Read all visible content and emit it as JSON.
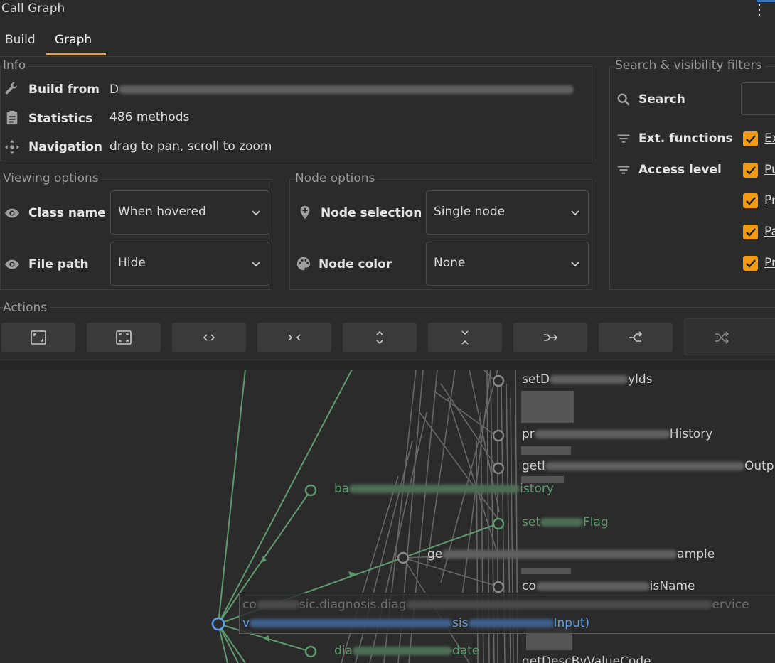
{
  "window": {
    "title": "Call Graph"
  },
  "tabs": [
    {
      "label": "Build",
      "active": false
    },
    {
      "label": "Graph",
      "active": true
    }
  ],
  "info": {
    "legend": "Info",
    "build_from": {
      "label": "Build from",
      "value_prefix": "D"
    },
    "statistics": {
      "label": "Statistics",
      "value": "486 methods"
    },
    "navigation": {
      "label": "Navigation",
      "value": "drag to pan, scroll to zoom"
    }
  },
  "viewing_options": {
    "legend": "Viewing options",
    "class_name": {
      "label": "Class name",
      "selected": "When hovered"
    },
    "file_path": {
      "label": "File path",
      "selected": "Hide"
    }
  },
  "node_options": {
    "legend": "Node options",
    "node_selection": {
      "label": "Node selection",
      "selected": "Single node"
    },
    "node_color": {
      "label": "Node color",
      "selected": "None"
    }
  },
  "filters": {
    "legend": "Search & visibility filters",
    "search": {
      "label": "Search",
      "value": ""
    },
    "ext_functions": {
      "label": "Ext. functions"
    },
    "access_level": {
      "label": "Access level"
    },
    "checkboxes": [
      {
        "label": "Ex",
        "checked": true
      },
      {
        "label": "Pu",
        "checked": true
      },
      {
        "label": "Pr",
        "checked": true
      },
      {
        "label": "Pa",
        "checked": true
      },
      {
        "label": "Pr",
        "checked": true
      }
    ]
  },
  "actions": {
    "legend": "Actions",
    "buttons": [
      {
        "icon": "fit-to-view-icon"
      },
      {
        "icon": "fit-selection-icon"
      },
      {
        "icon": "expand-horizontal-icon"
      },
      {
        "icon": "collapse-horizontal-icon"
      },
      {
        "icon": "expand-vertical-icon"
      },
      {
        "icon": "collapse-vertical-icon"
      },
      {
        "icon": "merge-right-icon"
      },
      {
        "icon": "split-right-icon"
      },
      {
        "icon": "shuffle-icon"
      }
    ]
  },
  "graph": {
    "nodes": [
      {
        "prefix": "setD",
        "suffix": "ylds",
        "color": "gray"
      },
      {
        "prefix": "pr",
        "suffix": "History",
        "color": "gray"
      },
      {
        "prefix": "getI",
        "suffix": "Outp",
        "color": "gray"
      },
      {
        "prefix": "ba",
        "suffix": "istory",
        "color": "green"
      },
      {
        "prefix": "set",
        "suffix": "Flag",
        "color": "green"
      },
      {
        "prefix": "ge",
        "suffix": "ample",
        "color": "gray"
      },
      {
        "prefix": "co",
        "suffix": "isName",
        "color": "gray"
      },
      {
        "prefix": "dia",
        "suffix": "date",
        "color": "green"
      },
      {
        "prefix": "getDescByValueCode",
        "suffix": "",
        "color": "gray"
      }
    ],
    "tooltip": {
      "line1_prefix": "co",
      "line1_middle": "sic.diagnosis.diag",
      "line1_suffix": "ervice",
      "line2_prefix": "v",
      "line2_middle": "sis",
      "line2_suffix": "Input)"
    },
    "colors": {
      "green": "#5f9a6e",
      "gray": "#6e6e6e",
      "blue": "#5d9ee8"
    }
  }
}
